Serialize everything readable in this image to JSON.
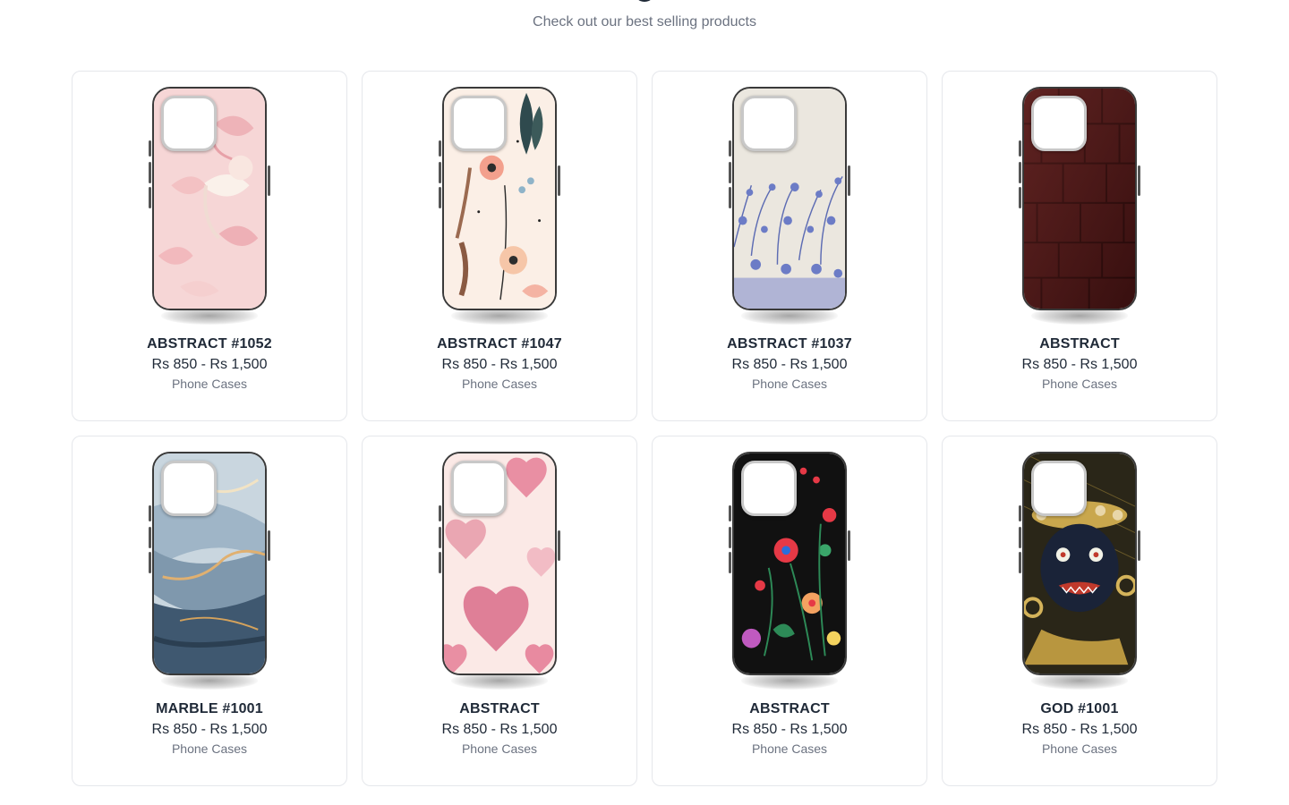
{
  "section": {
    "subtitle": "Check out our best selling products"
  },
  "products": [
    {
      "name": "ABSTRACT #1052",
      "price": "Rs 850 - Rs 1,500",
      "category": "Phone Cases",
      "design": "pink-bows"
    },
    {
      "name": "ABSTRACT #1047",
      "price": "Rs 850 - Rs 1,500",
      "category": "Phone Cases",
      "design": "cream-floral"
    },
    {
      "name": "ABSTRACT #1037",
      "price": "Rs 850 - Rs 1,500",
      "category": "Phone Cases",
      "design": "blue-botanical"
    },
    {
      "name": "ABSTRACT",
      "price": "Rs 850 - Rs 1,500",
      "category": "Phone Cases",
      "design": "croc-leather"
    },
    {
      "name": "MARBLE #1001",
      "price": "Rs 850 - Rs 1,500",
      "category": "Phone Cases",
      "design": "blue-marble"
    },
    {
      "name": "ABSTRACT",
      "price": "Rs 850 - Rs 1,500",
      "category": "Phone Cases",
      "design": "pink-hearts"
    },
    {
      "name": "ABSTRACT",
      "price": "Rs 850 - Rs 1,500",
      "category": "Phone Cases",
      "design": "dark-floral"
    },
    {
      "name": "GOD #1001",
      "price": "Rs 850 - Rs 1,500",
      "category": "Phone Cases",
      "design": "deity-art"
    }
  ]
}
